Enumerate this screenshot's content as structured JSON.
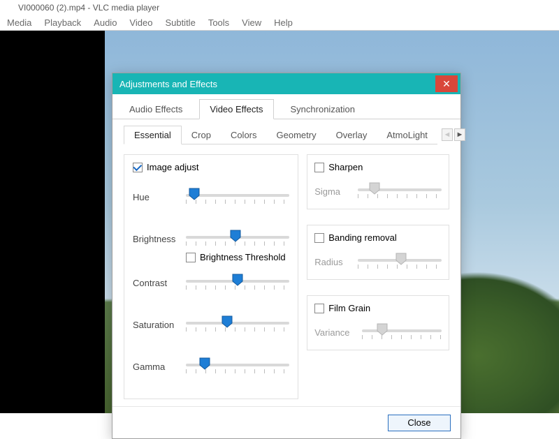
{
  "window": {
    "title": "VI000060 (2).mp4 - VLC media player"
  },
  "menubar": [
    "Media",
    "Playback",
    "Audio",
    "Video",
    "Subtitle",
    "Tools",
    "View",
    "Help"
  ],
  "dialog": {
    "title": "Adjustments and Effects",
    "close_glyph": "✕",
    "tabs": [
      "Audio Effects",
      "Video Effects",
      "Synchronization"
    ],
    "active_tab": "Video Effects",
    "inner_tabs": [
      "Essential",
      "Crop",
      "Colors",
      "Geometry",
      "Overlay",
      "AtmoLight"
    ],
    "active_inner_tab": "Essential",
    "scroll_left": "◄",
    "scroll_right": "►",
    "close_button": "Close"
  },
  "essential": {
    "left": {
      "image_adjust": {
        "label": "Image adjust",
        "checked": true
      },
      "hue": {
        "label": "Hue",
        "value": 8,
        "enabled": true
      },
      "brightness": {
        "label": "Brightness",
        "value": 48,
        "enabled": true
      },
      "brightness_threshold": {
        "label": "Brightness Threshold",
        "checked": false
      },
      "contrast": {
        "label": "Contrast",
        "value": 50,
        "enabled": true
      },
      "saturation": {
        "label": "Saturation",
        "value": 40,
        "enabled": true
      },
      "gamma": {
        "label": "Gamma",
        "value": 18,
        "enabled": true
      }
    },
    "right": {
      "sharpen": {
        "label": "Sharpen",
        "checked": false,
        "sigma": {
          "label": "Sigma",
          "value": 20,
          "enabled": false
        }
      },
      "banding": {
        "label": "Banding removal",
        "checked": false,
        "radius": {
          "label": "Radius",
          "value": 52,
          "enabled": false
        }
      },
      "film_grain": {
        "label": "Film Grain",
        "checked": false,
        "variance": {
          "label": "Variance",
          "value": 25,
          "enabled": false
        }
      }
    }
  }
}
